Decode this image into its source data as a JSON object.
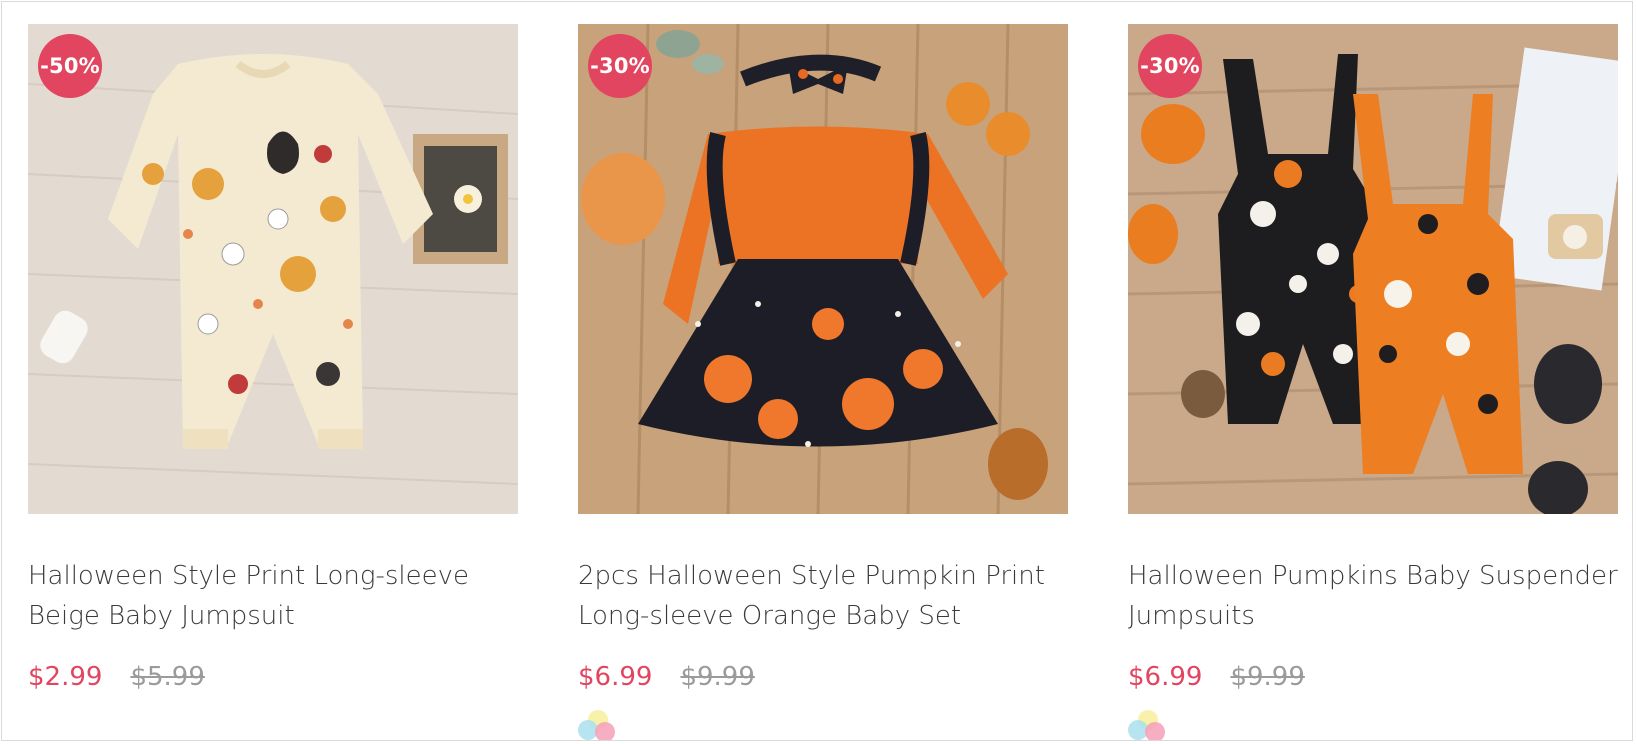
{
  "products": [
    {
      "badge": "-50%",
      "title_line1": "Halloween Style Print Long-sleeve",
      "title_line2": "Beige Baby Jumpsuit",
      "price": "$2.99",
      "original_price": "$5.99",
      "has_color_swatches": false
    },
    {
      "badge": "-30%",
      "title_line1": "2pcs Halloween Style Pumpkin Print",
      "title_line2": "Long-sleeve Orange Baby Set",
      "price": "$6.99",
      "original_price": "$9.99",
      "has_color_swatches": true
    },
    {
      "badge": "-30%",
      "title_line1": "Halloween Pumpkins Baby Suspender",
      "title_line2": "Jumpsuits",
      "price": "$6.99",
      "original_price": "$9.99",
      "has_color_swatches": true
    }
  ],
  "colors": {
    "accent": "#e2455f",
    "strike_price": "#9b9b9b",
    "title_text": "#3a3a3a"
  },
  "icons": {
    "color_swatch": "color-swatch-icon"
  }
}
